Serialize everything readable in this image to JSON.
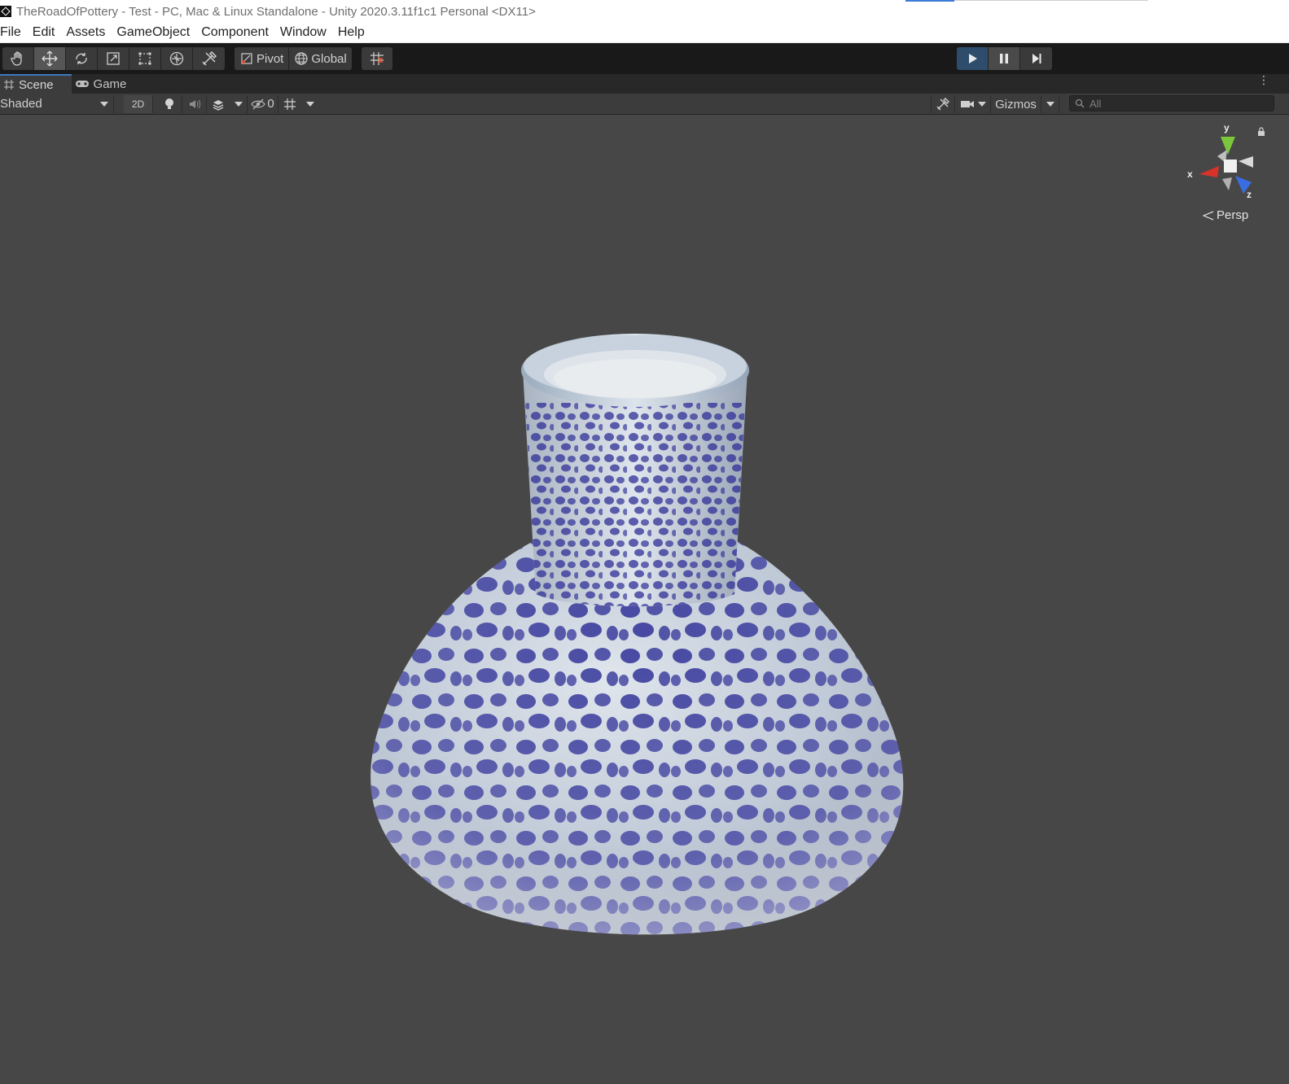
{
  "window": {
    "title": "TheRoadOfPottery - Test - PC, Mac & Linux Standalone - Unity 2020.3.11f1c1 Personal <DX11>"
  },
  "menu": [
    "File",
    "Edit",
    "Assets",
    "GameObject",
    "Component",
    "Window",
    "Help"
  ],
  "toolbar": {
    "tools": [
      "hand-icon",
      "move-icon",
      "rotate-icon",
      "scale-icon",
      "rect-icon",
      "transform-icon",
      "custom-tool-icon"
    ],
    "active_tool": "move-icon",
    "pivot_label": "Pivot",
    "global_label": "Global"
  },
  "tabs": {
    "scene": "Scene",
    "game": "Game"
  },
  "scene_toolbar": {
    "draw_mode": "Shaded",
    "mode_2d": "2D",
    "hidden_count": "0",
    "gizmos_label": "Gizmos",
    "search_placeholder": "All"
  },
  "gizmo": {
    "y_label": "y",
    "x_label": "x",
    "z_label": "z",
    "projection": "Persp"
  },
  "colors": {
    "play_active": "#2e4d6d",
    "axis_x": "#d8322b",
    "axis_y": "#7bc63a",
    "axis_z": "#3a6de0",
    "vase_glaze": "#c9d3de",
    "vase_pattern": "#2e2f96"
  }
}
